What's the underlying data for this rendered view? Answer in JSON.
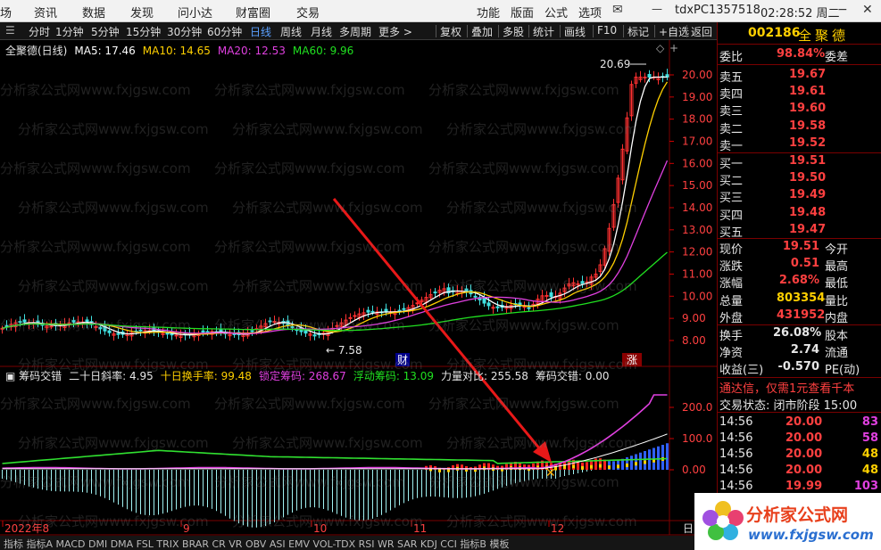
{
  "menu": {
    "left": [
      "场",
      "资讯",
      "数据",
      "发现",
      "问小达",
      "财富圈",
      "交易"
    ],
    "right": [
      "功能",
      "版面",
      "公式",
      "选项"
    ],
    "client_id": "tdxPC1357518",
    "clock": "02:28:52 周二"
  },
  "tabs": [
    "分时",
    "1分钟",
    "5分钟",
    "15分钟",
    "30分钟",
    "60分钟",
    "日线",
    "周线",
    "月线",
    "多周期",
    "更多 >"
  ],
  "active_tab": "日线",
  "toolbar_right": [
    "复权",
    "叠加",
    "多股",
    "统计",
    "画线",
    "F10",
    "标记",
    "+自选",
    "返回"
  ],
  "main_header": {
    "name": "全聚德(日线)",
    "ma": [
      {
        "label": "MA5: 17.46",
        "color": "#ffffff"
      },
      {
        "label": "MA10: 14.65",
        "color": "#ffd000"
      },
      {
        "label": "MA20: 12.53",
        "color": "#e040e0"
      },
      {
        "label": "MA60: 9.96",
        "color": "#20e020"
      }
    ]
  },
  "price_axis": [
    "20.00",
    "19.00",
    "18.00",
    "17.00",
    "16.00",
    "15.00",
    "14.00",
    "13.00",
    "12.00",
    "11.00",
    "10.00",
    "9.00",
    "8.00"
  ],
  "annotations": {
    "high": "20.69",
    "low": "7.58",
    "tag1": "财",
    "tag2": "涨"
  },
  "sub_header": {
    "name": "筹码交错",
    "items": [
      {
        "label": "二十日斜率: 4.95",
        "color": "#e6e6e6"
      },
      {
        "label": "十日换手率: 99.48",
        "color": "#ffd000"
      },
      {
        "label": "锁定筹码: 268.67",
        "color": "#e040e0"
      },
      {
        "label": "浮动筹码: 13.09",
        "color": "#20e020"
      },
      {
        "label": "力量对比: 255.58",
        "color": "#e6e6e6"
      },
      {
        "label": "筹码交错: 0.00",
        "color": "#e6e6e6"
      }
    ]
  },
  "sub_axis": [
    "200.0",
    "100.0",
    "0.00"
  ],
  "date_axis": [
    "2022年8",
    "9",
    "10",
    "11",
    "12"
  ],
  "bottom_tabs_text": "指标 指标A MACD DMI DMA FSL TRIX BRAR CR VR OBV ASI EMV VOL-TDX RSI WR SAR KDJ CCI 指标B 模板",
  "right_panel": {
    "code": "002186",
    "name": "全聚德",
    "weibi": {
      "label": "委比",
      "value": "98.84%",
      "right": "委差"
    },
    "asks": [
      {
        "label": "卖五",
        "price": "19.67"
      },
      {
        "label": "卖四",
        "price": "19.61"
      },
      {
        "label": "卖三",
        "price": "19.60"
      },
      {
        "label": "卖二",
        "price": "19.58"
      },
      {
        "label": "卖一",
        "price": "19.52"
      }
    ],
    "bids": [
      {
        "label": "买一",
        "price": "19.51"
      },
      {
        "label": "买二",
        "price": "19.50"
      },
      {
        "label": "买三",
        "price": "19.49"
      },
      {
        "label": "买四",
        "price": "19.48"
      },
      {
        "label": "买五",
        "price": "19.47"
      }
    ],
    "quote": [
      {
        "label": "现价",
        "value": "19.51",
        "right": "今开",
        "color": "#ff4040"
      },
      {
        "label": "涨跌",
        "value": "0.51",
        "right": "最高",
        "color": "#ff4040"
      },
      {
        "label": "涨幅",
        "value": "2.68%",
        "right": "最低",
        "color": "#ff4040"
      },
      {
        "label": "总量",
        "value": "803354",
        "right": "量比",
        "color": "#ffd000"
      },
      {
        "label": "外盘",
        "value": "431952",
        "right": "内盘",
        "color": "#ff4040"
      }
    ],
    "quote2": [
      {
        "label": "换手",
        "value": "26.08%",
        "right": "股本",
        "color": "#e6e6e6"
      },
      {
        "label": "净资",
        "value": "2.74",
        "right": "流通",
        "color": "#e6e6e6"
      },
      {
        "label": "收益(三)",
        "value": "-0.570",
        "right": "PE(动)",
        "color": "#e6e6e6"
      }
    ],
    "ad": "通达信，仅需1元查看千本",
    "trade_status": "交易状态: 闭市阶段 15:00",
    "ticks": [
      {
        "time": "14:56",
        "price": "20.00",
        "vol": "83",
        "vc": "#e040e0"
      },
      {
        "time": "14:56",
        "price": "20.00",
        "vol": "58",
        "vc": "#e040e0"
      },
      {
        "time": "14:56",
        "price": "20.00",
        "vol": "48",
        "vc": "#ffd000"
      },
      {
        "time": "14:56",
        "price": "20.00",
        "vol": "48",
        "vc": "#ffd000"
      },
      {
        "time": "14:56",
        "price": "19.99",
        "vol": "103",
        "vc": "#e040e0"
      }
    ]
  },
  "watermark": "分析家公式网www.fxjgsw.com",
  "logo": {
    "title": "分析家公式网",
    "url": "www.fxjgsw.com"
  }
}
